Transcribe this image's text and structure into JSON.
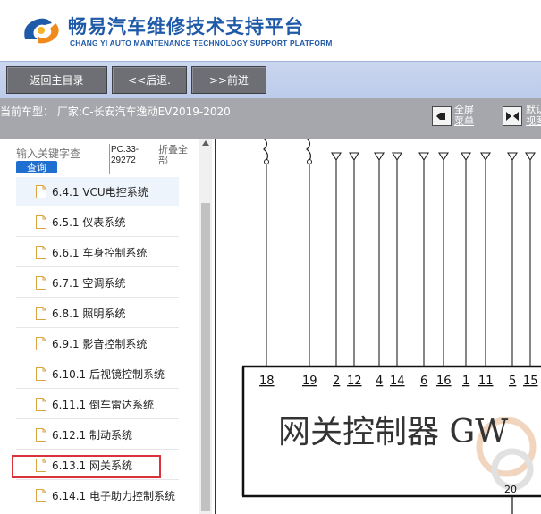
{
  "header": {
    "title_cn": "畅易汽车维修技术支持平台",
    "title_en": "CHANG YI AUTO MAINTENANCE TECHNOLOGY SUPPORT PLATFORM"
  },
  "nav": {
    "home_label": "返回主目录",
    "back_label": "<<后退.",
    "forward_label": ">>前进"
  },
  "infobar": {
    "car_info": "当前车型：  厂家:C-长安汽车逸动EV2019-2020",
    "fullscreen_line1": "全屏",
    "fullscreen_line2": "菜单",
    "adjust_line1": "默认",
    "adjust_line2": "视图"
  },
  "sidebar": {
    "keyword_placeholder": "输入关键字查",
    "query_label": "查询",
    "pc_line1": "PC.33-",
    "pc_line2": "29272",
    "collapse_line1": "折叠全",
    "collapse_line2": "部",
    "items": [
      {
        "label": "6.4.1 VCU电控系统"
      },
      {
        "label": "6.5.1 仪表系统"
      },
      {
        "label": "6.6.1 车身控制系统"
      },
      {
        "label": "6.7.1 空调系统"
      },
      {
        "label": "6.8.1 照明系统"
      },
      {
        "label": "6.9.1 影音控制系统"
      },
      {
        "label": "6.10.1 后视镜控制系统"
      },
      {
        "label": "6.11.1 倒车雷达系统"
      },
      {
        "label": "6.12.1 制动系统"
      },
      {
        "label": "6.13.1 网关系统"
      },
      {
        "label": "6.14.1 电子助力控制系统"
      }
    ],
    "selected_index": 9
  },
  "diagram": {
    "component_label": "网关控制器 GW",
    "pins": [
      "18",
      "19",
      "2",
      "12",
      "4",
      "14",
      "6",
      "16",
      "1",
      "11",
      "5",
      "15"
    ],
    "bottom_pin": "20"
  },
  "colors": {
    "brand_blue": "#1f5aa8",
    "nav_bg": "#c4d0ec",
    "button_gray": "#6d6f74",
    "info_bar_gray": "#a5a7ac",
    "highlight_red": "#d9333a"
  }
}
